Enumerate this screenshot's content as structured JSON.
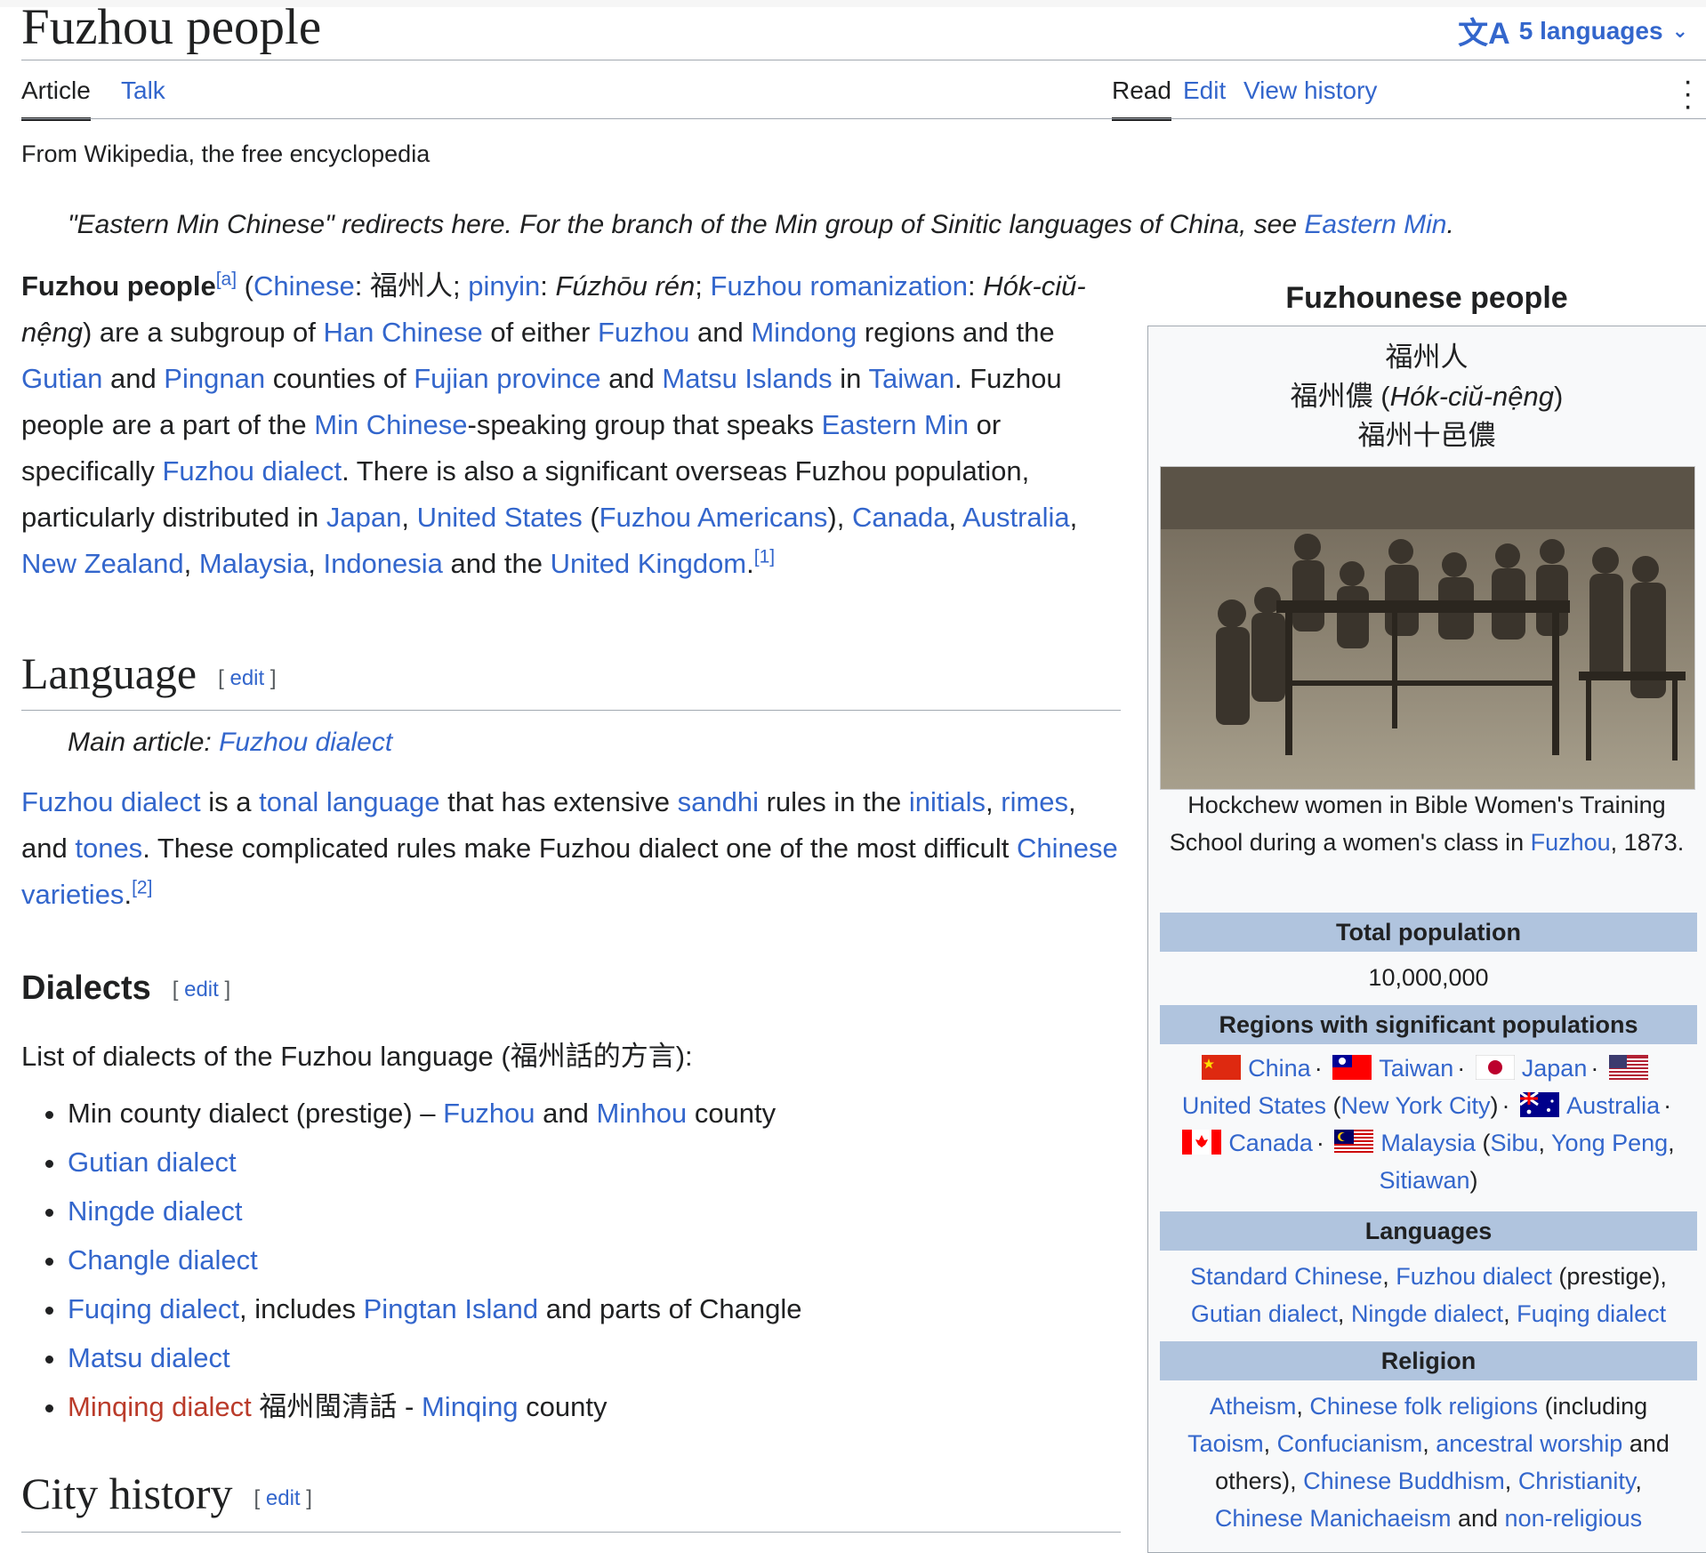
{
  "page": {
    "title": "Fuzhou people",
    "languages_label": "5 languages",
    "tagline": "From Wikipedia, the free encyclopedia"
  },
  "tabs": {
    "article": "Article",
    "talk": "Talk",
    "read": "Read",
    "edit": "Edit",
    "history": "View history"
  },
  "hatnote": {
    "text": "\"Eastern Min Chinese\" redirects here. For the branch of the Min group of Sinitic languages of China, see ",
    "link": "Eastern Min",
    "end": "."
  },
  "lead": {
    "bold": "Fuzhou people",
    "ref_a": "[a]",
    "chinese": "Chinese",
    "hanzi": "福州人",
    "pinyin": "pinyin",
    "pinyin_val": "Fúzhōu rén",
    "romanization": "Fuzhou romanization",
    "rom_val": "Hók-ciŭ-nệng",
    "han_chinese": "Han Chinese",
    "fuzhou": "Fuzhou",
    "mindong": "Mindong",
    "gutian": "Gutian",
    "pingnan": "Pingnan",
    "fujian": "Fujian province",
    "matsu": "Matsu Islands",
    "taiwan": "Taiwan",
    "min_chinese": "Min Chinese",
    "eastern_min": "Eastern Min",
    "fuzhou_dialect": "Fuzhou dialect",
    "japan": "Japan",
    "us": "United States",
    "fuzhou_americans": "Fuzhou Americans",
    "canada": "Canada",
    "australia": "Australia",
    "nz": "New Zealand",
    "malaysia": "Malaysia",
    "indonesia": "Indonesia",
    "uk": "United Kingdom",
    "ref_1": "[1]"
  },
  "language": {
    "heading": "Language",
    "edit": "edit",
    "main_label": "Main article: ",
    "main_link": "Fuzhou dialect",
    "fuzhou_dialect": "Fuzhou dialect",
    "tonal": "tonal language",
    "sandhi": "sandhi",
    "initials": "initials",
    "rimes": "rimes",
    "tones": "tones",
    "varieties": "Chinese varieties",
    "ref_2": "[2]"
  },
  "dialects": {
    "heading": "Dialects",
    "edit": "edit",
    "intro": "List of dialects of the Fuzhou language (福州話的方言):",
    "min_county": "Min county dialect (prestige) – ",
    "fuzhou": "Fuzhou",
    "minhou": "Minhou",
    "county": "county",
    "gutian": "Gutian dialect",
    "ningde": "Ningde dialect",
    "changle": "Changle dialect",
    "fuqing": "Fuqing dialect",
    "includes": ", includes ",
    "pingtan": "Pingtan Island",
    "parts": "and parts of Changle",
    "matsu": "Matsu dialect",
    "minqing_dialect": "Minqing dialect",
    "minqing_hanzi": "福州閩清話 - ",
    "minqing": "Minqing"
  },
  "city_history": {
    "heading": "City history",
    "edit": "edit"
  },
  "infobox": {
    "title": "Fuzhounese people",
    "name1": "福州人",
    "name2_hanzi": "福州儂 (",
    "name2_rom": "Hók-ciŭ-nệng",
    "name2_end": ")",
    "name3": "福州十邑儂",
    "image_caption_pre": "Hockchew women in Bible Women's Training School during a women's class in ",
    "image_caption_link": "Fuzhou",
    "image_caption_post": ", 1873.",
    "total_pop_label": "Total population",
    "total_pop_value": "10,000,000",
    "regions_label": "Regions with significant populations",
    "regions": {
      "china": "China",
      "taiwan": "Taiwan",
      "japan": "Japan",
      "us": "United States",
      "nyc": "New York City",
      "australia": "Australia",
      "canada": "Canada",
      "malaysia": "Malaysia",
      "sibu": "Sibu",
      "yong_peng": "Yong Peng",
      "sitiawan": "Sitiawan"
    },
    "languages_label": "Languages",
    "languages": {
      "standard": "Standard Chinese",
      "fuzhou": "Fuzhou dialect",
      "prestige": " (prestige),",
      "gutian": "Gutian dialect",
      "ningde": "Ningde dialect",
      "fuqing": "Fuqing dialect"
    },
    "religion_label": "Religion",
    "religion": {
      "atheism": "Atheism",
      "folk": "Chinese folk religions",
      "including": " (including",
      "taoism": "Taoism",
      "confucianism": "Confucianism",
      "ancestral": "ancestral worship",
      "and_others": "others), ",
      "buddhism": "Chinese Buddhism",
      "christianity": "Christianity",
      "manichaeism": "Chinese Manichaeism",
      "nonrel": "non-religious"
    }
  },
  "colors": {
    "link": "#3366cc",
    "redlink": "#ba3b2a",
    "text": "#202122",
    "infobox_header": "#b0c4de"
  }
}
